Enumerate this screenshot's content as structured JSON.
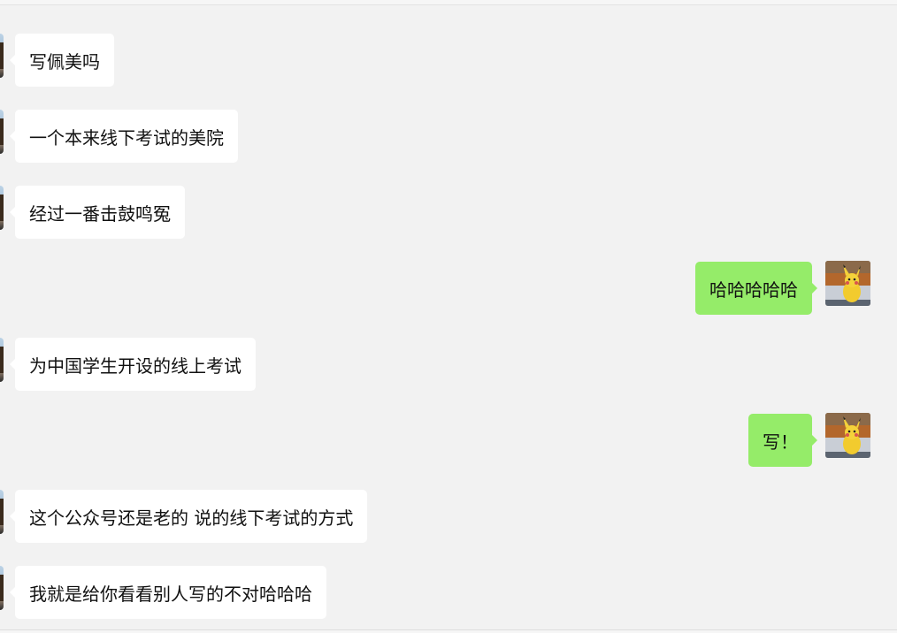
{
  "messages": [
    {
      "direction": "in",
      "text": "写佩美吗"
    },
    {
      "direction": "in",
      "text": "一个本来线下考试的美院"
    },
    {
      "direction": "in",
      "text": "经过一番击鼓鸣冤"
    },
    {
      "direction": "out",
      "text": "哈哈哈哈哈"
    },
    {
      "direction": "in",
      "text": "为中国学生开设的线上考试"
    },
    {
      "direction": "out",
      "text": "写！"
    },
    {
      "direction": "in",
      "text": "这个公众号还是老的 说的线下考试的方式"
    },
    {
      "direction": "in",
      "text": "我就是给你看看别人写的不对哈哈哈"
    }
  ],
  "colors": {
    "background": "#f2f2f2",
    "incoming_bubble": "#ffffff",
    "outgoing_bubble": "#95ec69"
  },
  "icons": {
    "incoming_avatar": "person-avatar",
    "outgoing_avatar": "pikachu-avatar"
  }
}
